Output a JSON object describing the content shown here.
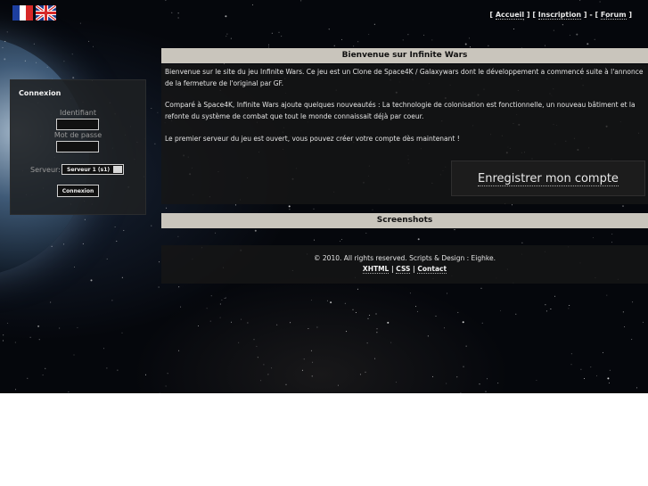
{
  "header": {
    "flags": [
      {
        "name": "flag-fr-icon",
        "lang": "fr"
      },
      {
        "name": "flag-uk-icon",
        "lang": "en"
      }
    ],
    "nav": [
      {
        "label": "Accueil"
      },
      {
        "label": "Inscription"
      },
      {
        "label": "Forum"
      }
    ]
  },
  "login": {
    "title": "Connexion",
    "username_label": "Identifiant",
    "username_value": "",
    "password_label": "Mot de passe",
    "password_value": "",
    "server_label": "Serveur:",
    "server_selected": "Serveur 1 (s1)",
    "submit_label": "Connexion"
  },
  "welcome": {
    "title": "Bienvenue sur Infinite Wars",
    "paragraphs": [
      "Bienvenue sur le site du jeu Infinite Wars. Ce jeu est un Clone de Space4K / Galaxywars dont le développement a commencé suite à l'annonce de la fermeture de l'original par GF.",
      "Comparé à Space4K, Infinite Wars ajoute quelques nouveautés : La technologie de colonisation est fonctionnelle, un nouveau bâtiment et la refonte du système de combat que tout le monde connaissait déjà par coeur.",
      "Le premier serveur du jeu est ouvert, vous pouvez créer votre compte dès maintenant !"
    ],
    "register_label": "Enregistrer mon compte"
  },
  "screenshots": {
    "title": "Screenshots"
  },
  "footer": {
    "copyright": "© 2010. All rights reserved. Scripts & Design : Eighke.",
    "links": [
      "XHTML",
      "CSS",
      "Contact"
    ]
  },
  "colors": {
    "panel_header": "#c9c5bc",
    "panel_body": "#161616",
    "background": "#05070c"
  }
}
